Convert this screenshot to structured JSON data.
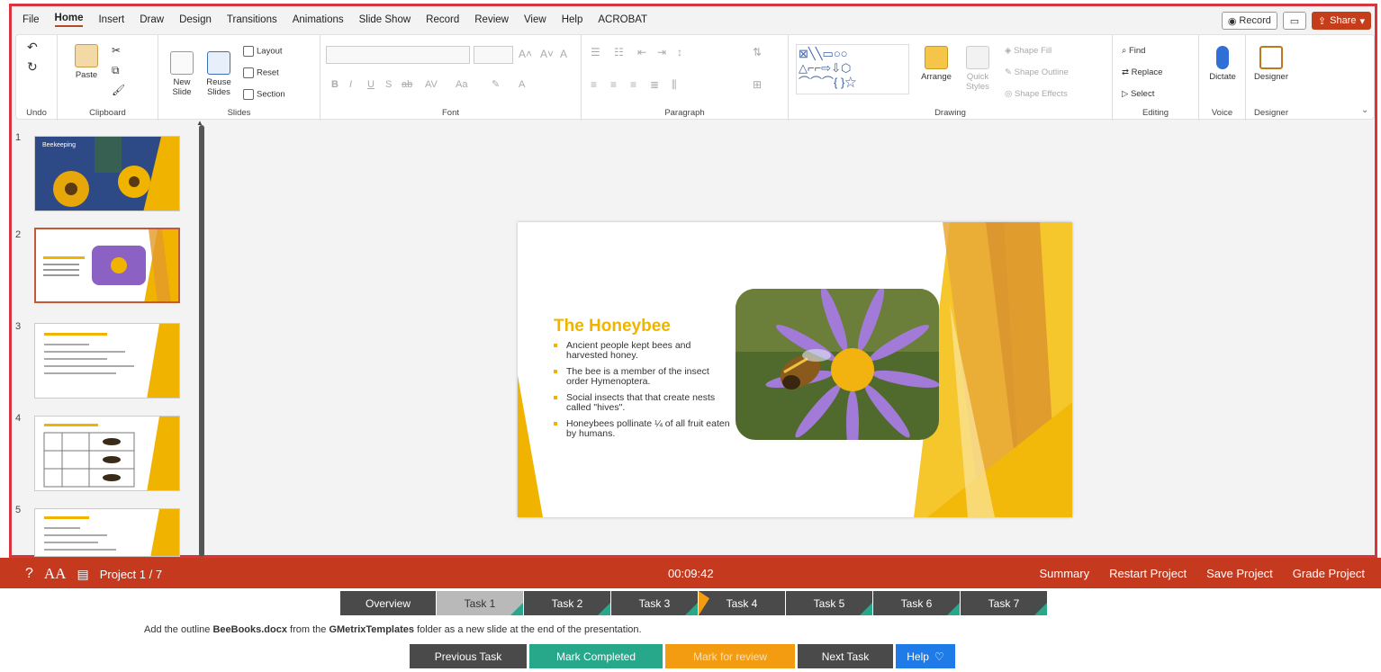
{
  "menu": {
    "tabs": [
      "File",
      "Home",
      "Insert",
      "Draw",
      "Design",
      "Transitions",
      "Animations",
      "Slide Show",
      "Record",
      "Review",
      "View",
      "Help",
      "ACROBAT"
    ],
    "active_tab": "Home",
    "record_label": "Record",
    "share_label": "Share"
  },
  "ribbon": {
    "undo": {
      "label": "Undo"
    },
    "clipboard": {
      "label": "Clipboard",
      "paste": "Paste"
    },
    "slides": {
      "label": "Slides",
      "new_slide": "New Slide",
      "reuse_slides": "Reuse Slides",
      "layout": "Layout",
      "reset": "Reset",
      "section": "Section"
    },
    "font": {
      "label": "Font"
    },
    "paragraph": {
      "label": "Paragraph"
    },
    "drawing": {
      "label": "Drawing",
      "arrange": "Arrange",
      "quick_styles": "Quick Styles",
      "shape_fill": "Shape Fill",
      "shape_outline": "Shape Outline",
      "shape_effects": "Shape Effects"
    },
    "editing": {
      "label": "Editing",
      "find": "Find",
      "replace": "Replace",
      "select": "Select"
    },
    "voice": {
      "label": "Voice",
      "dictate": "Dictate"
    },
    "designer": {
      "label": "Designer",
      "designer_btn": "Designer"
    }
  },
  "thumbnails": {
    "numbers": [
      "1",
      "2",
      "3",
      "4",
      "5"
    ],
    "slide1_title": "Beekeeping",
    "selected": "2"
  },
  "slide": {
    "title": "The Honeybee",
    "bullets": [
      "Ancient people kept bees and harvested honey.",
      "The bee is a member of the insect order Hymenoptera.",
      "Social insects that that create nests called \"hives\".",
      "Honeybees pollinate ¼ of all fruit eaten by humans."
    ]
  },
  "bottom_bar": {
    "project": "Project 1 / 7",
    "timer": "00:09:42",
    "links": [
      "Summary",
      "Restart Project",
      "Save Project",
      "Grade Project"
    ]
  },
  "tasks": [
    "Overview",
    "Task 1",
    "Task 2",
    "Task 3",
    "Task 4",
    "Task 5",
    "Task 6",
    "Task 7"
  ],
  "instruction": {
    "prefix": "Add the outline ",
    "file": "BeeBooks.docx",
    "middle": " from the ",
    "folder": "GMetrixTemplates",
    "suffix": " folder as a new slide at the end of the presentation."
  },
  "actions": {
    "previous": "Previous Task",
    "complete": "Mark Completed",
    "review": "Mark for review",
    "next": "Next Task",
    "help": "Help"
  },
  "colors": {
    "accent_red": "#c5391f",
    "slide_gold": "#f0b400",
    "complete_green": "#27a88a",
    "review_orange": "#f39c12",
    "help_blue": "#1e7be8"
  }
}
